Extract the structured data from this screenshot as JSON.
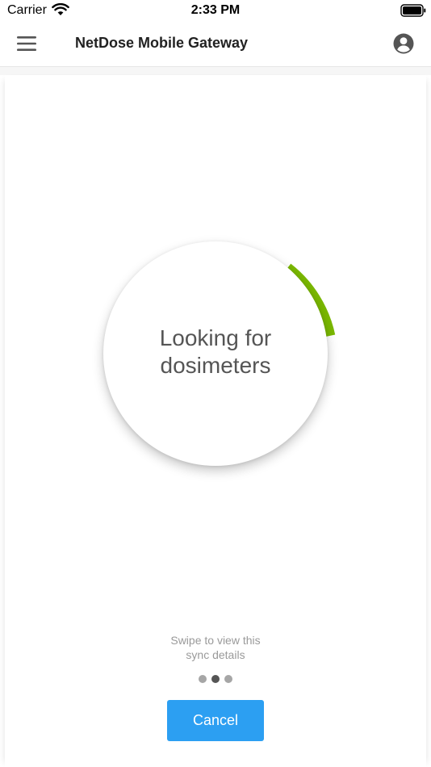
{
  "status_bar": {
    "carrier": "Carrier",
    "time": "2:33 PM",
    "icons": [
      "wifi-icon",
      "battery-icon"
    ]
  },
  "nav": {
    "title": "NetDose Mobile Gateway",
    "left_icon": "menu-icon",
    "right_icon": "account-icon"
  },
  "sync": {
    "status_line1": "Looking for",
    "status_line2": "dosimeters",
    "progress_color": "#7ab800"
  },
  "pager": {
    "hint_line1": "Swipe to view this",
    "hint_line2": "sync details",
    "page_count": 3,
    "active_index": 1
  },
  "actions": {
    "cancel_label": "Cancel",
    "cancel_color": "#2c9ff2"
  }
}
